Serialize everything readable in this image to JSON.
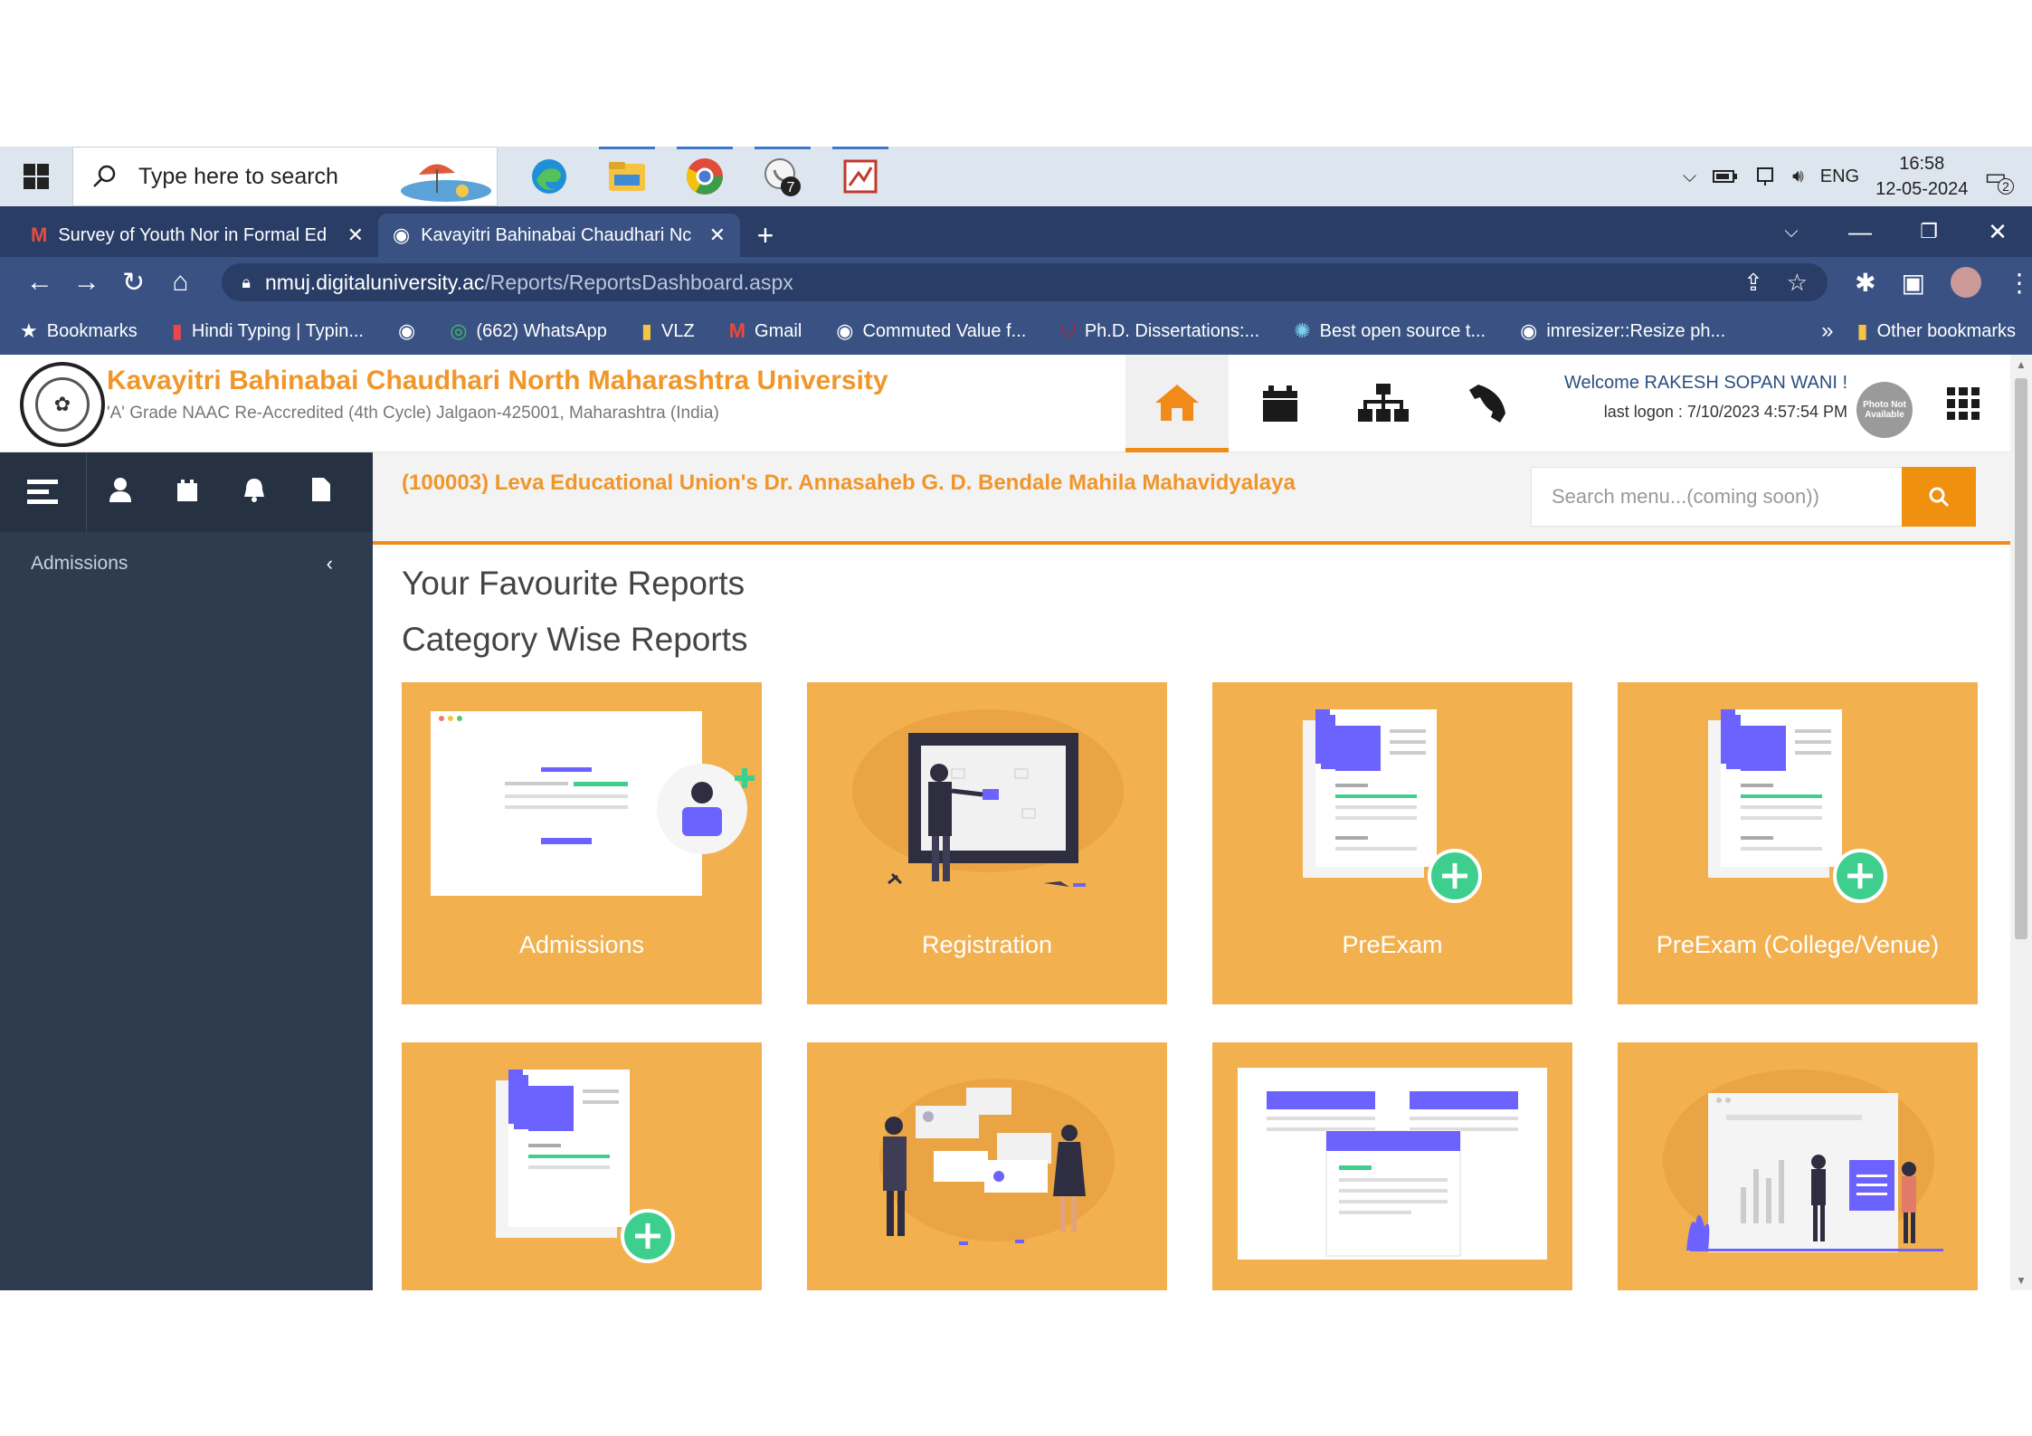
{
  "taskbar": {
    "search_placeholder": "Type here to search",
    "language": "ENG",
    "time": "16:58",
    "date": "12-05-2024",
    "notification_count": "2",
    "whatsapp_badge": "7"
  },
  "tabs": [
    {
      "title": "Survey of Youth Nor in Formal Ed",
      "icon": "gmail-icon"
    },
    {
      "title": "Kavayitri Bahinabai Chaudhari Nc",
      "icon": "globe-icon"
    }
  ],
  "address": {
    "host": "nmuj.digitaluniversity.ac",
    "path": "/Reports/ReportsDashboard.aspx"
  },
  "bookmarks": [
    {
      "label": "Bookmarks",
      "icon": "star-icon"
    },
    {
      "label": "Hindi Typing | Typin...",
      "icon": "bookmark-favicon-icon"
    },
    {
      "label": "",
      "icon": "globe-icon"
    },
    {
      "label": "(662) WhatsApp",
      "icon": "whatsapp-icon"
    },
    {
      "label": "VLZ",
      "icon": "folder-icon"
    },
    {
      "label": "Gmail",
      "icon": "gmail-icon"
    },
    {
      "label": "Commuted Value f...",
      "icon": "globe-icon"
    },
    {
      "label": "Ph.D. Dissertations:...",
      "icon": "shield-icon"
    },
    {
      "label": "Best open source t...",
      "icon": "gear-icon"
    },
    {
      "label": "imresizer::Resize ph...",
      "icon": "globe-icon"
    }
  ],
  "bookmarks_more": "»",
  "other_bookmarks": "Other bookmarks",
  "header": {
    "university_name": "Kavayitri Bahinabai Chaudhari North Maharashtra University",
    "subtitle": "'A' Grade NAAC Re-Accredited (4th Cycle) Jalgaon-425001, Maharashtra (India)",
    "welcome": "Welcome RAKESH SOPAN WANI !",
    "last_logon": "last logon : 7/10/2023 4:57:54 PM",
    "avatar_text": "Photo Not Available"
  },
  "sidebar": {
    "menu_item": "Admissions"
  },
  "main": {
    "college": "(100003) Leva Educational Union's Dr. Annasaheb G. D. Bendale Mahila Mahavidyalaya",
    "search_placeholder": "Search menu...(coming soon))",
    "favourite_title": "Your Favourite Reports",
    "category_title": "Category Wise Reports",
    "cards": [
      "Admissions",
      "Registration",
      "PreExam",
      "PreExam (College/Venue)",
      "",
      "",
      "",
      ""
    ]
  },
  "colors": {
    "accent": "#f08a19",
    "card": "#f2b04f",
    "sidebar": "#2f3c4f",
    "browser": "#3a5283"
  }
}
